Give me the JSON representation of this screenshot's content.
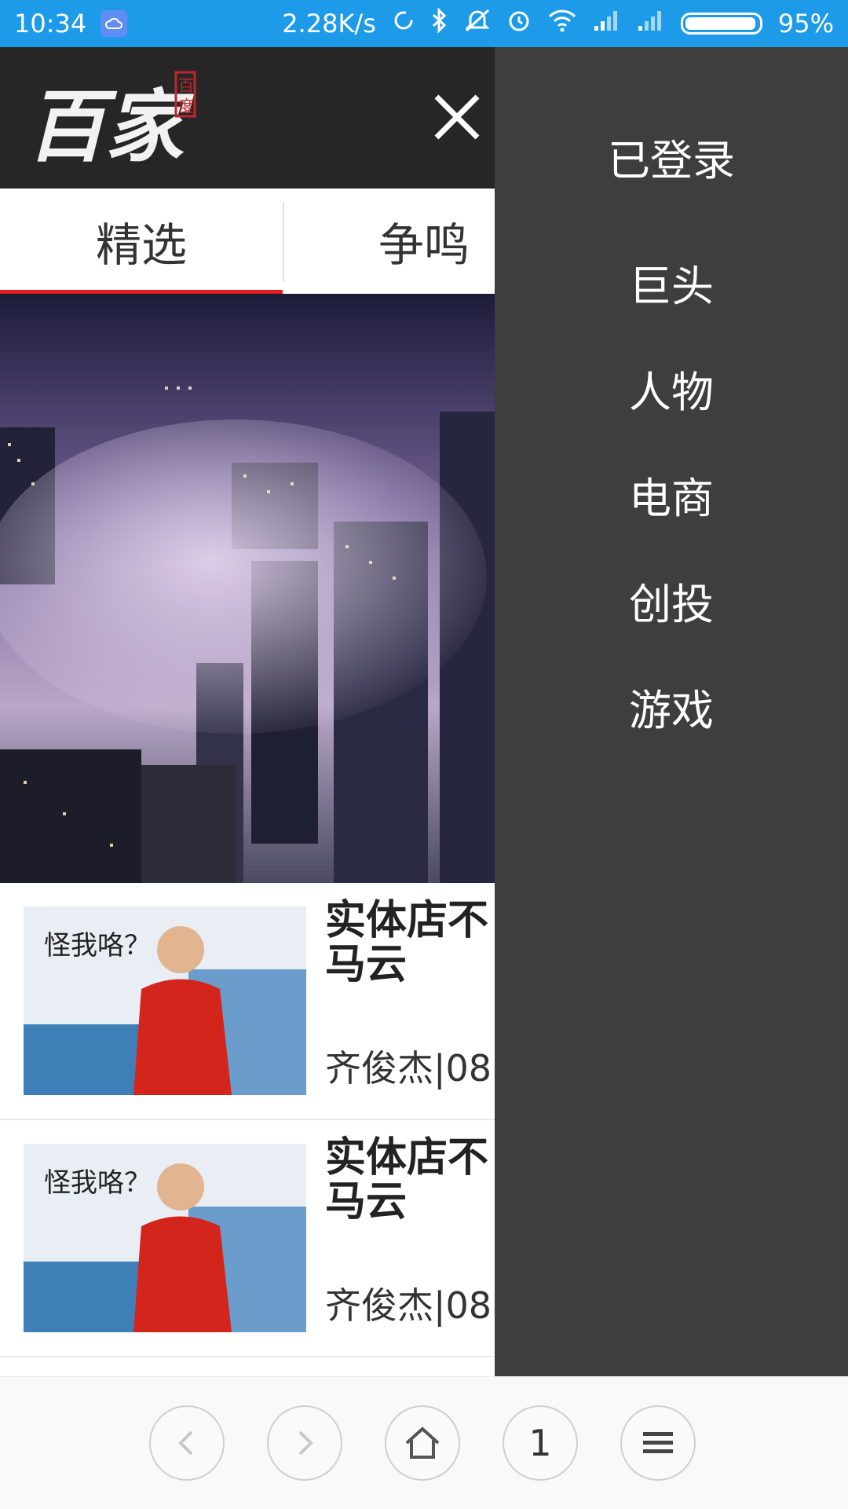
{
  "status_bar": {
    "time": "10:34",
    "speed": "2.28K/s",
    "battery": "95%"
  },
  "header": {
    "logo_text": "百家",
    "logo_seal": "百度"
  },
  "tabs": [
    {
      "label": "精选",
      "active": true
    },
    {
      "label": "争鸣",
      "active": false
    }
  ],
  "news": [
    {
      "thumb_caption": "怪我咯？",
      "title_line1": "实体店不",
      "title_line2": "马云",
      "meta": "齐俊杰|08:"
    },
    {
      "thumb_caption": "怪我咯？",
      "title_line1": "实体店不",
      "title_line2": "马云",
      "meta": "齐俊杰|08:"
    }
  ],
  "drawer": {
    "status": "已登录",
    "items": [
      "巨头",
      "人物",
      "电商",
      "创投",
      "游戏"
    ]
  },
  "bottom_nav": {
    "tabs_count": "1"
  },
  "colors": {
    "status_bar": "#1e9be8",
    "header": "#262626",
    "drawer": "#3e3e3e",
    "active_tab_underline": "#e02020"
  }
}
